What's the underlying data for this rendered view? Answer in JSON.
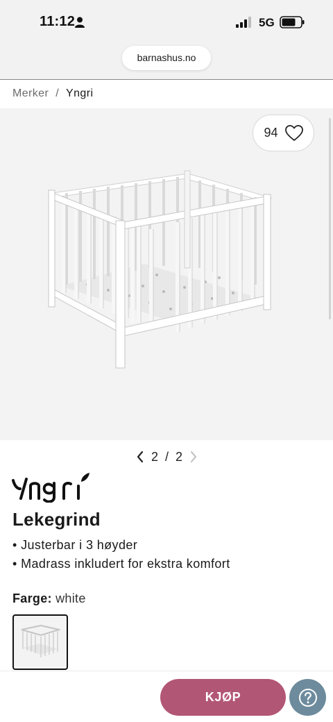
{
  "status_bar": {
    "time": "11:12",
    "network": "5G",
    "icons": [
      "person-icon",
      "signal-icon",
      "battery-icon"
    ]
  },
  "browser": {
    "url": "barnashus.no"
  },
  "breadcrumb": {
    "items": [
      "Merker",
      "Yngri"
    ],
    "separator": "/"
  },
  "gallery": {
    "favorite_count": "94",
    "favorite_icon": "heart-icon",
    "pager": {
      "current": "2",
      "separator": "/",
      "total": "2"
    }
  },
  "product": {
    "brand": "Yngri",
    "title": "Lekegrind",
    "features": [
      "Justerbar i 3 høyder",
      "Madrass inkludert for ekstra komfort"
    ],
    "color_label": "Farge:",
    "color_value": "white"
  },
  "actions": {
    "buy_label": "KJØP",
    "help_icon": "question-icon"
  },
  "colors": {
    "buy": "#b25676",
    "help": "#6d8b9d",
    "gallery_bg": "#f3f3f3"
  }
}
